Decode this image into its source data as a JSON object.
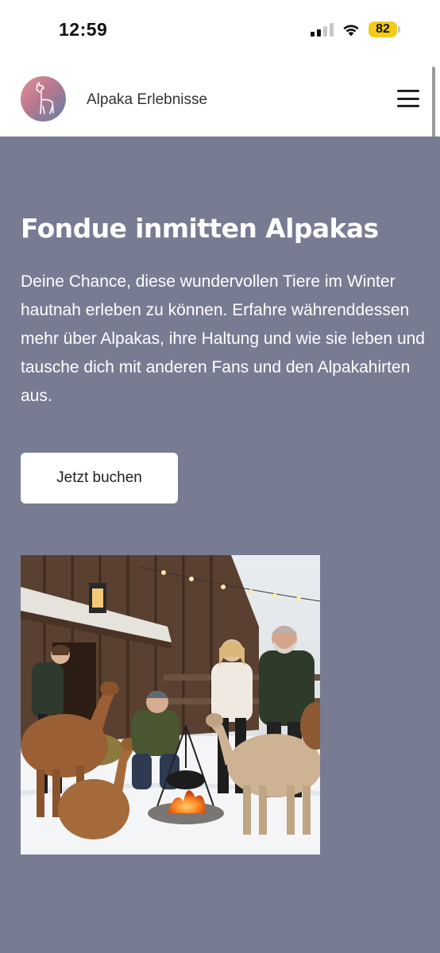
{
  "status_bar": {
    "time": "12:59",
    "battery": "82"
  },
  "header": {
    "title": "Alpaka Erlebnisse",
    "logo_icon": "alpaca-logo-icon",
    "menu_icon": "hamburger-menu-icon"
  },
  "hero": {
    "title": "Fondue inmitten Alpakas",
    "text": "Deine Chance, diese wundervollen Tiere im Winter hautnah erleben zu können. Erfahre währenddessen mehr über Alpakas, ihre Haltung und wie sie leben und tausche dich mit anderen Fans und den Alpakahirten aus.",
    "cta_label": "Jetzt buchen",
    "background_color": "#777c93"
  },
  "colors": {
    "battery": "#f2cb1d",
    "logo_gradient_start": "#e39095",
    "logo_gradient_end": "#5e7fa6"
  }
}
